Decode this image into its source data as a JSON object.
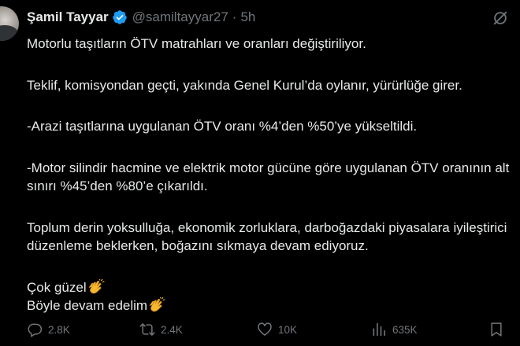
{
  "tweet": {
    "author_name": "Şamil Tayyar",
    "handle": "@samiltayyar27",
    "separator": "·",
    "time": "5h",
    "paragraphs": [
      "Motorlu taşıtların ÖTV matrahları ve oranları değiştiriliyor.",
      "Teklif, komisyondan geçti, yakında Genel Kurul’da oylanır, yürürlüğe girer.",
      "-Arazi taşıtlarına uygulanan ÖTV oranı %4’den %50’ye yükseltildi.",
      "-Motor silindir hacmine ve elektrik motor gücüne göre uygulanan ÖTV oranının alt sınırı %45’den %80’e çıkarıldı.",
      "Toplum derin yoksulluğa, ekonomik zorluklara, darboğazdaki piyasalara iyileştirici düzenleme beklerken, boğazını sıkmaya devam ediyoruz."
    ],
    "closing_line_1": "Çok güzel",
    "closing_line_2": "Böyle devam edelim",
    "emoji": "clapping-hands"
  },
  "actions": {
    "replies": "2.8K",
    "reposts": "2.4K",
    "likes": "10K",
    "views": "635K"
  },
  "colors": {
    "background": "#000000",
    "text": "#e7e9ea",
    "secondary": "#71767b",
    "verified": "#1d9bf0"
  }
}
